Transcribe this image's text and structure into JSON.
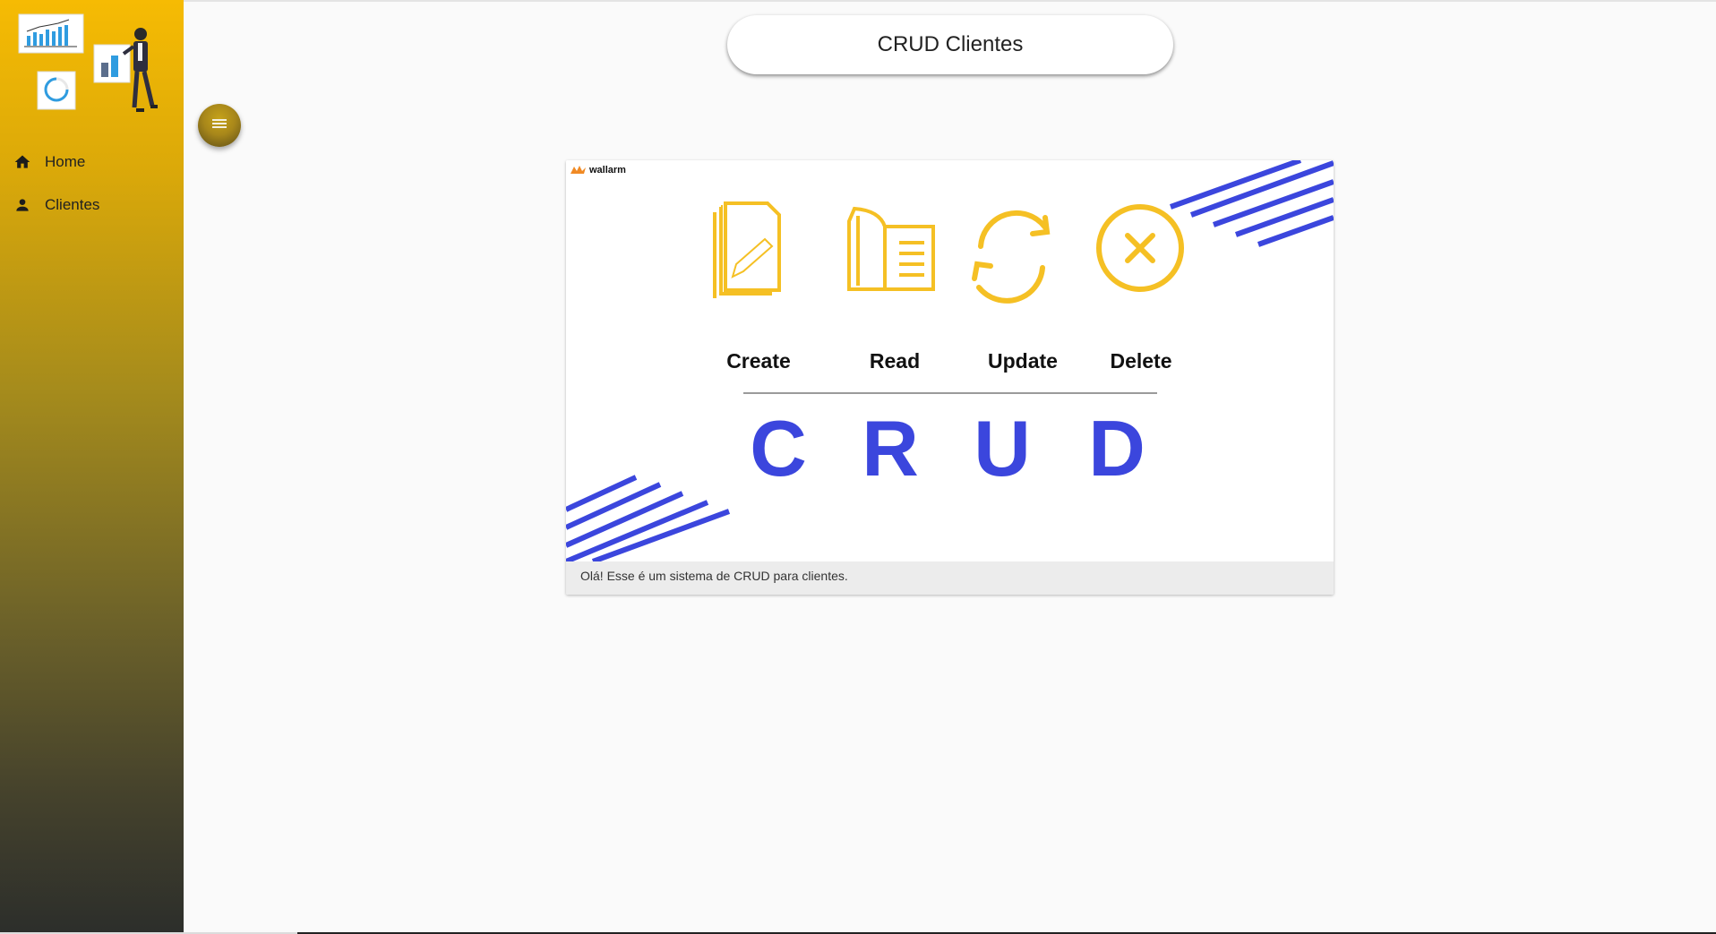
{
  "app": {
    "title": "CRUD Clientes"
  },
  "sidebar": {
    "items": [
      {
        "label": "Home",
        "icon": "home-icon"
      },
      {
        "label": "Clientes",
        "icon": "person-icon"
      }
    ]
  },
  "menu_button": {
    "icon": "menu-icon"
  },
  "card": {
    "image": {
      "brand": "wallarm",
      "operations": [
        "Create",
        "Read",
        "Update",
        "Delete"
      ],
      "letters": [
        "C",
        "R",
        "U",
        "D"
      ],
      "colors": {
        "accent_yellow": "#f5c024",
        "accent_blue": "#3b46dd"
      }
    },
    "caption": "Olá! Esse é um sistema de CRUD para clientes."
  },
  "colors": {
    "sidebar_top": "#f6bb03",
    "sidebar_bottom": "#2c2e2b",
    "page_bg": "#fafafa"
  }
}
